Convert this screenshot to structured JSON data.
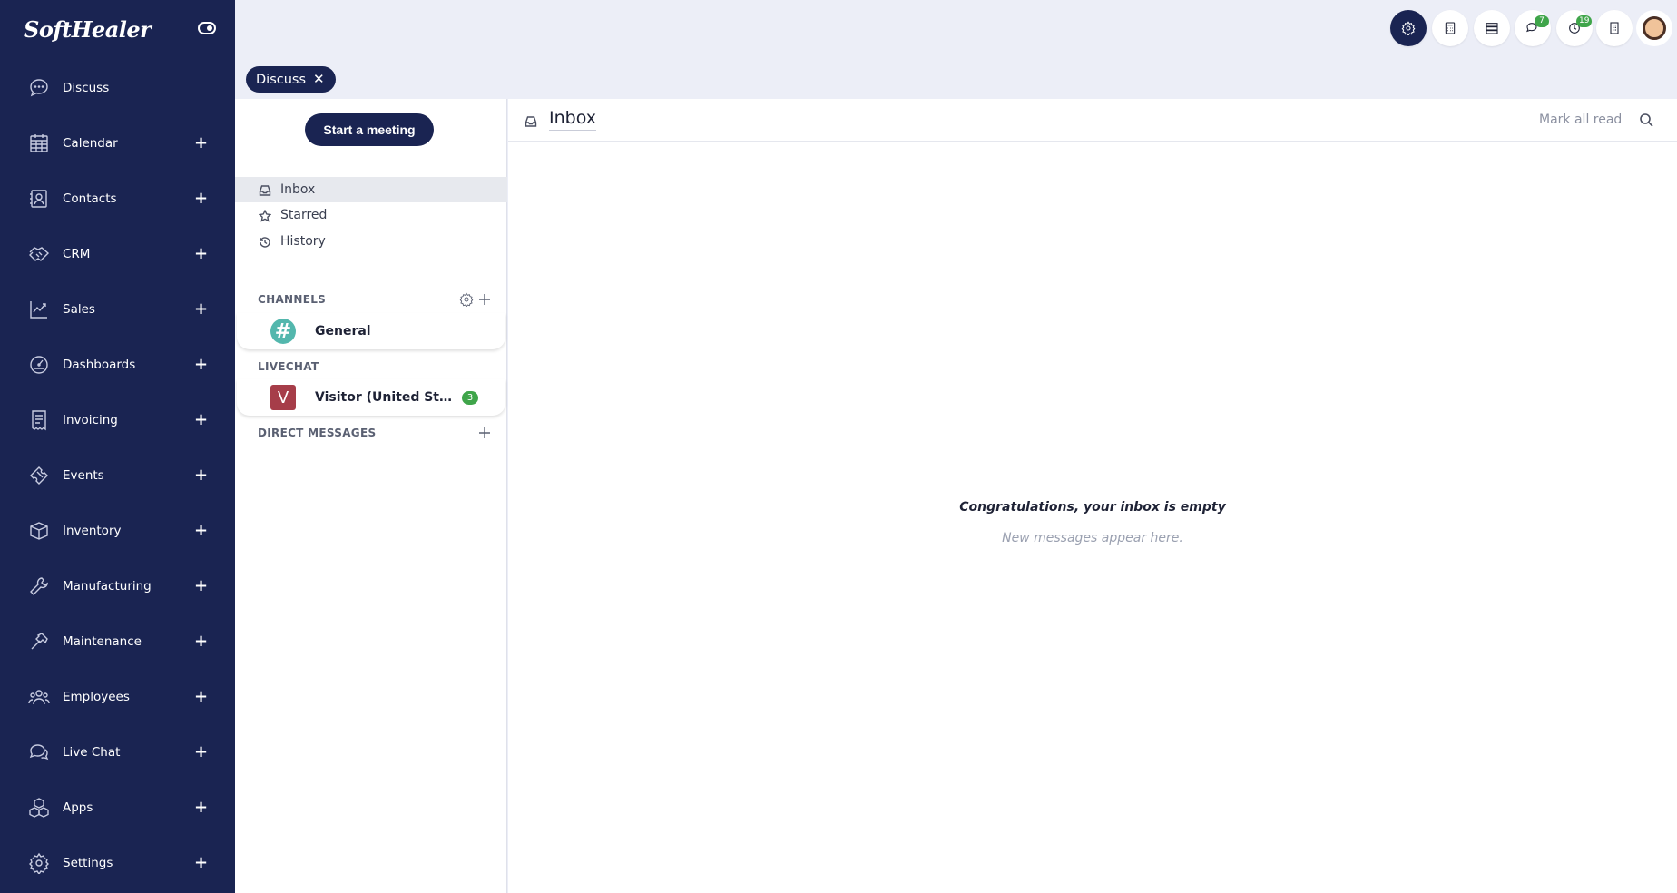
{
  "brand": {
    "name": "SoftHealer"
  },
  "sidebar": {
    "items": [
      {
        "label": "Discuss",
        "icon": "chat-bubble-icon",
        "has_plus": false
      },
      {
        "label": "Calendar",
        "icon": "calendar-icon",
        "has_plus": true
      },
      {
        "label": "Contacts",
        "icon": "contacts-icon",
        "has_plus": true
      },
      {
        "label": "CRM",
        "icon": "handshake-icon",
        "has_plus": true
      },
      {
        "label": "Sales",
        "icon": "chart-line-icon",
        "has_plus": true
      },
      {
        "label": "Dashboards",
        "icon": "gauge-icon",
        "has_plus": true
      },
      {
        "label": "Invoicing",
        "icon": "receipt-icon",
        "has_plus": true
      },
      {
        "label": "Events",
        "icon": "ticket-icon",
        "has_plus": true
      },
      {
        "label": "Inventory",
        "icon": "box-icon",
        "has_plus": true
      },
      {
        "label": "Manufacturing",
        "icon": "wrench-icon",
        "has_plus": true
      },
      {
        "label": "Maintenance",
        "icon": "hammer-icon",
        "has_plus": true
      },
      {
        "label": "Employees",
        "icon": "people-icon",
        "has_plus": true
      },
      {
        "label": "Live Chat",
        "icon": "chats-icon",
        "has_plus": true
      },
      {
        "label": "Apps",
        "icon": "cubes-icon",
        "has_plus": true
      },
      {
        "label": "Settings",
        "icon": "gear-icon",
        "has_plus": true
      }
    ],
    "plus_symbol": "+"
  },
  "topbar": {
    "chat_badge": "7",
    "activity_badge": "19"
  },
  "breadcrumb": {
    "label": "Discuss",
    "close": "✕"
  },
  "discuss": {
    "start_meeting": "Start a meeting",
    "mailboxes": [
      {
        "label": "Inbox",
        "icon": "inbox-icon",
        "active": true
      },
      {
        "label": "Starred",
        "icon": "star-icon",
        "active": false
      },
      {
        "label": "History",
        "icon": "history-icon",
        "active": false
      }
    ],
    "channels_label": "CHANNELS",
    "channels": [
      {
        "name": "General",
        "avatar": "#"
      }
    ],
    "livechat_label": "LIVECHAT",
    "livechats": [
      {
        "name": "Visitor (United States)",
        "avatar": "V",
        "counter": "3"
      }
    ],
    "direct_label": "DIRECT MESSAGES"
  },
  "main": {
    "title": "Inbox",
    "mark_all_read": "Mark all read",
    "empty_title": "Congratulations, your inbox is empty",
    "empty_subtitle": "New messages appear here."
  }
}
